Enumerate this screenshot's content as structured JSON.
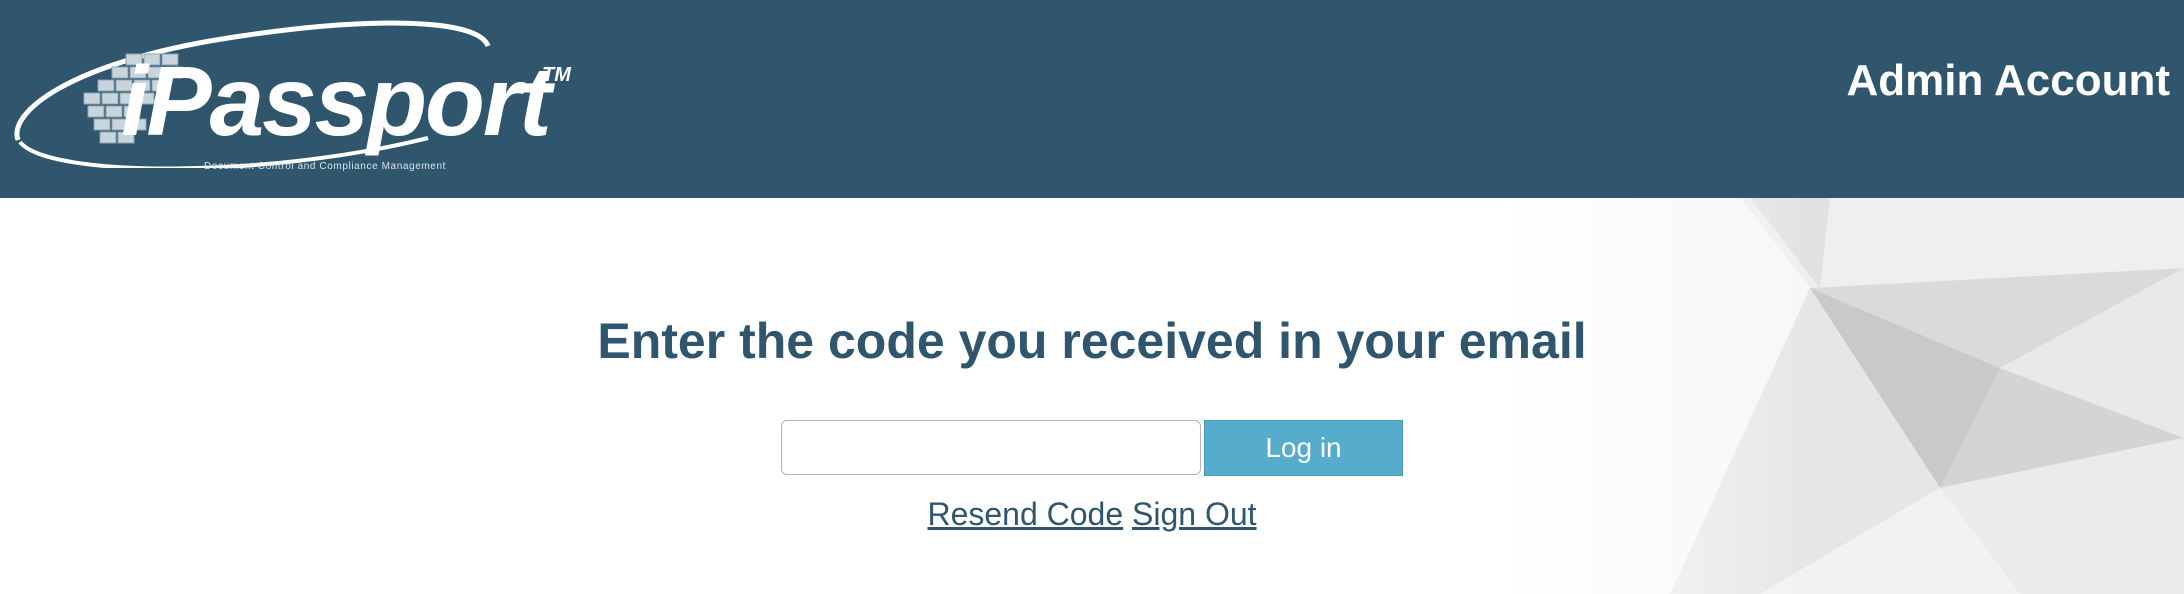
{
  "header": {
    "logo": {
      "brand": "iPassport",
      "trademark": "TM",
      "tagline": "Document Control and Compliance Management"
    },
    "account_title": "Admin Account"
  },
  "main": {
    "heading": "Enter the code you received in your email",
    "code_input": {
      "value": "",
      "placeholder": ""
    },
    "login_button_label": "Log in",
    "links": {
      "resend_code": "Resend Code",
      "sign_out": "Sign Out"
    }
  },
  "colors": {
    "header_bg": "#2f566c",
    "heading_text": "#2f566c",
    "button_bg": "#55adcb",
    "button_text": "#ffffff",
    "page_bg": "#ffffff"
  },
  "icons": {
    "logo_mark": "grid-swoosh-logo-icon"
  }
}
